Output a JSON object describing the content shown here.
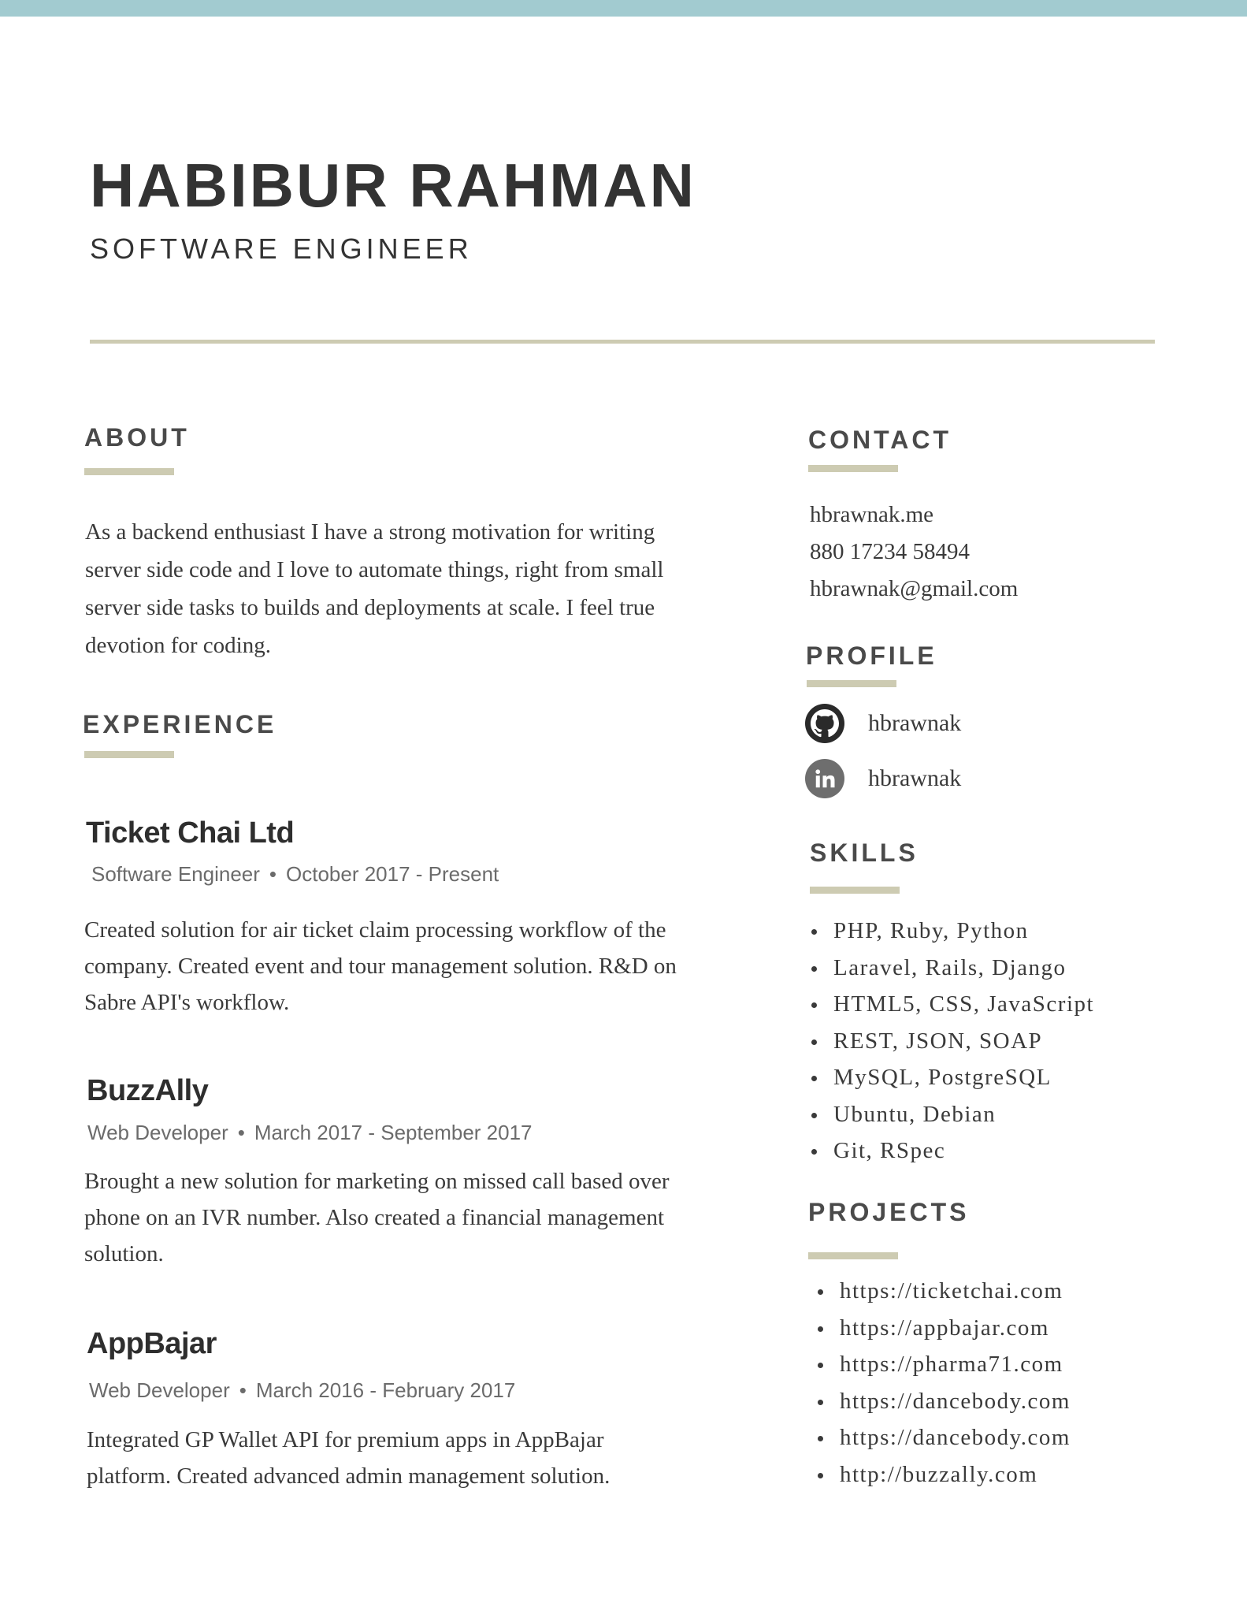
{
  "header": {
    "name": "HABIBUR RAHMAN",
    "title": "SOFTWARE ENGINEER"
  },
  "about": {
    "heading": "ABOUT",
    "lines": [
      "As a backend enthusiast I have a strong motivation for writing",
      "server side code and I love to automate things, right from small",
      "server side tasks to builds and deployments at scale. I feel true",
      "devotion for coding."
    ]
  },
  "experience": {
    "heading": "EXPERIENCE",
    "jobs": [
      {
        "company": "Ticket Chai Ltd",
        "role": "Software Engineer",
        "period": "October 2017 - Present",
        "lines": [
          "Created solution for air ticket claim processing workflow of the",
          "company. Created event and tour management solution. R&D on",
          "Sabre API's workflow."
        ]
      },
      {
        "company": "BuzzAlly",
        "role": "Web Developer",
        "period": "March 2017 - September 2017",
        "lines": [
          "Brought a new solution for marketing on missed call based over",
          "phone on an IVR number. Also created a financial management",
          "solution."
        ]
      },
      {
        "company": "AppBajar",
        "role": "Web Developer",
        "period": "March 2016 - February 2017",
        "lines": [
          "Integrated GP Wallet API for premium apps in AppBajar",
          "platform.  Created advanced admin management solution."
        ]
      }
    ]
  },
  "contact": {
    "heading": "CONTACT",
    "website": "hbrawnak.me",
    "phone": "880 17234 58494",
    "email": "hbrawnak@gmail.com"
  },
  "profile": {
    "heading": "PROFILE",
    "github": {
      "icon": "github-icon",
      "handle": "hbrawnak"
    },
    "linkedin": {
      "icon": "linkedin-icon",
      "handle": "hbrawnak"
    }
  },
  "skills": {
    "heading": "SKILLS",
    "items": [
      "PHP, Ruby, Python",
      "Laravel, Rails, Django",
      "HTML5, CSS, JavaScript",
      "REST, JSON, SOAP",
      "MySQL, PostgreSQL",
      "Ubuntu, Debian",
      "Git, RSpec"
    ]
  },
  "projects": {
    "heading": "PROJECTS",
    "items": [
      "https://ticketchai.com",
      "https://appbajar.com",
      "https://pharma71.com",
      "https://dancebody.com",
      "https://dancebody.com",
      "http://buzzally.com"
    ]
  },
  "colors": {
    "top_bar": "#a2cbd0",
    "accent": "#cdcbb2",
    "text": "#333333"
  }
}
